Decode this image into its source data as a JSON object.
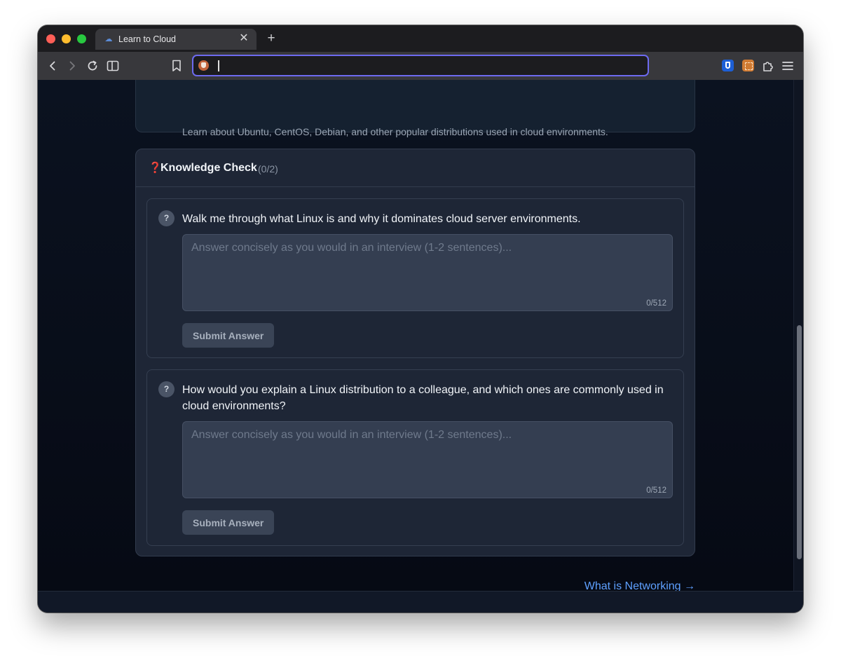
{
  "browser": {
    "tab": {
      "title": "Learn to Cloud",
      "close_glyph": "✕",
      "favicon": "cloud-icon"
    },
    "new_tab_glyph": "+",
    "url": {
      "value": "",
      "placeholder": ""
    },
    "accent_color": "#6d6af0"
  },
  "page": {
    "previous_section": {
      "description": "Learn about Ubuntu, CentOS, Debian, and other popular distributions used in cloud environments."
    },
    "knowledge_check": {
      "icon_glyph": "❓",
      "title": "Knowledge Check",
      "progress": "(0/2)",
      "questions": [
        {
          "badge": "?",
          "text": "Walk me through what Linux is and why it dominates cloud server environments.",
          "answer_value": "",
          "answer_placeholder": "Answer concisely as you would in an interview (1-2 sentences)...",
          "char_count": "0/512",
          "submit_label": "Submit Answer"
        },
        {
          "badge": "?",
          "text": "How would you explain a Linux distribution to a colleague, and which ones are commonly used in cloud environments?",
          "answer_value": "",
          "answer_placeholder": "Answer concisely as you would in an interview (1-2 sentences)...",
          "char_count": "0/512",
          "submit_label": "Submit Answer"
        }
      ]
    },
    "next_link": "What is Networking →"
  }
}
